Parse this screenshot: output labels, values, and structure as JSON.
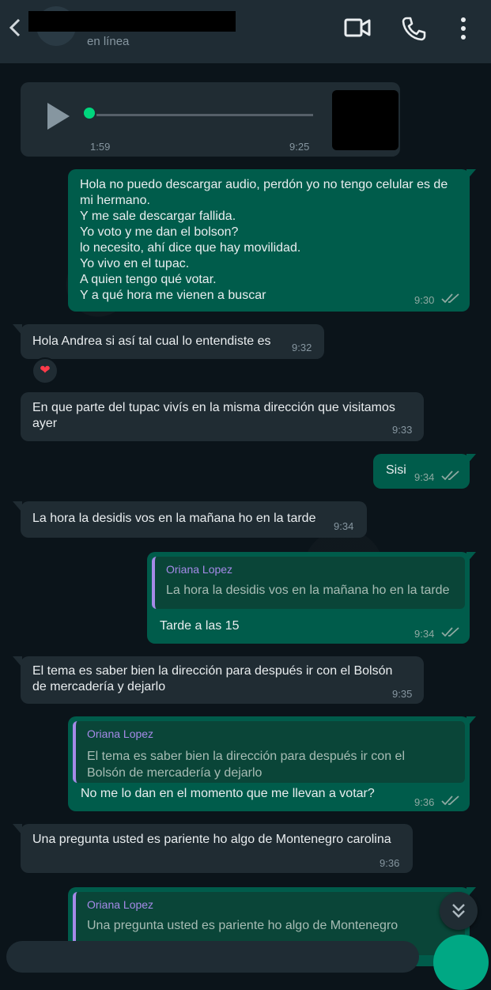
{
  "colors": {
    "header_bg": "#1f2c34",
    "incoming_bubble": "#202c33",
    "outgoing_bubble": "#005c4b",
    "quote_bar": "#a58ae8",
    "read_ticks": "#53bdeb",
    "accent_green": "#00a884"
  },
  "header": {
    "status": "en línea",
    "icons": [
      "back-arrow-icon",
      "video-call-icon",
      "phone-icon",
      "more-options-icon"
    ]
  },
  "messages": {
    "audio": {
      "duration": "1:59",
      "time": "9:25"
    },
    "m1": {
      "text": "Hola no puedo descargar audio, perdón yo no tengo celular es de\nmi hermano.\nY me sale descargar fallida.\nYo voto y me dan el bolson?\nlo necesito, ahí dice que hay movilidad.\nYo vivo en el tupac.\nA quien tengo qué votar.\nY a qué hora me vienen a buscar",
      "time": "9:30"
    },
    "m2": {
      "text": "Hola Andrea si así tal cual lo entendiste es",
      "time": "9:32",
      "reaction": "❤"
    },
    "m3": {
      "text": "En que parte del tupac vivís en la misma dirección que visitamos\nayer",
      "time": "9:33"
    },
    "m4": {
      "text": "Sisi",
      "time": "9:34"
    },
    "m5": {
      "text": "La hora la desidis vos en la mañana ho en la tarde",
      "time": "9:34"
    },
    "m6": {
      "quote_author": "Oriana Lopez",
      "quote_text": "La hora la desidis vos en la mañana ho en la tarde",
      "text": "Tarde a las 15",
      "time": "9:34"
    },
    "m7": {
      "text": "El tema es saber bien la dirección para después ir con el Bolsón\nde mercadería y dejarlo",
      "time": "9:35"
    },
    "m8": {
      "quote_author": "Oriana Lopez",
      "quote_text": "El tema es saber bien la dirección para después ir con el\nBolsón de mercadería y dejarlo",
      "text": "No me lo dan en el momento que me llevan a votar?",
      "time": "9:36"
    },
    "m9": {
      "text": "Una pregunta usted es pariente ho algo de Montenegro carolina",
      "time": "9:36"
    },
    "m10": {
      "quote_author": "Oriana Lopez",
      "quote_text": "Una pregunta usted es pariente ho algo de Montenegro"
    }
  }
}
